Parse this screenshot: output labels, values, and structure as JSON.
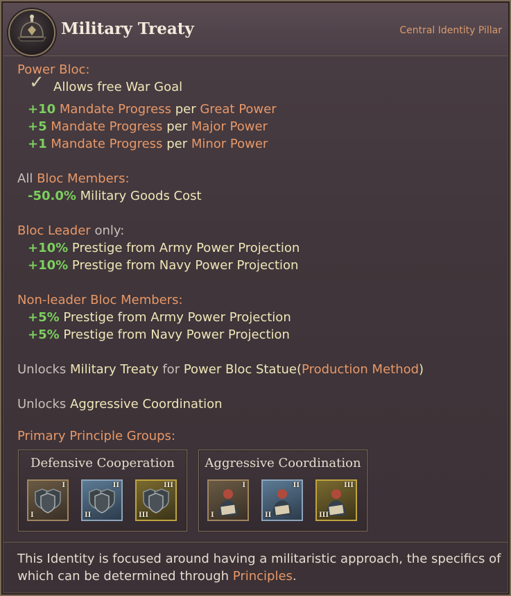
{
  "header": {
    "title": "Military Treaty",
    "pillar": "Central Identity Pillar",
    "emblem_icon": "pickelhaube-helmet-icon"
  },
  "power_bloc": {
    "label": "Power Bloc:",
    "free_war_goal": "Allows free War Goal",
    "check_icon": "checkmark-icon",
    "mandate": [
      {
        "value": "+10",
        "metric": "Mandate Progress",
        "per": "per",
        "target": "Great Power"
      },
      {
        "value": "+5",
        "metric": "Mandate Progress",
        "per": "per",
        "target": "Major Power"
      },
      {
        "value": "+1",
        "metric": "Mandate Progress",
        "per": "per",
        "target": "Minor Power"
      }
    ]
  },
  "all_members": {
    "prefix": "All",
    "label": "Bloc Members:",
    "effect_value": "-50.0%",
    "effect_text": "Military Goods Cost"
  },
  "leader": {
    "label": "Bloc Leader",
    "suffix": "only:",
    "effects": [
      {
        "value": "+10%",
        "text": "Prestige from Army Power Projection"
      },
      {
        "value": "+10%",
        "text": "Prestige from Navy Power Projection"
      }
    ]
  },
  "non_leader": {
    "label": "Non-leader Bloc Members:",
    "effects": [
      {
        "value": "+5%",
        "text": "Prestige from Army Power Projection"
      },
      {
        "value": "+5%",
        "text": "Prestige from Navy Power Projection"
      }
    ]
  },
  "unlock1": {
    "prefix": "Unlocks",
    "item": "Military Treaty",
    "for": "for",
    "building": "Power Bloc Statue",
    "open": "(",
    "method": "Production Method",
    "close": ")"
  },
  "unlock2": {
    "prefix": "Unlocks",
    "item": "Aggressive Coordination"
  },
  "principles": {
    "label": "Primary Principle Groups:",
    "groups": [
      {
        "name": "Defensive Cooperation",
        "icon": "shields-icon",
        "tiers": [
          {
            "tr": "I",
            "bl": "I"
          },
          {
            "tr": "II",
            "bl": "II"
          },
          {
            "tr": "III",
            "bl": "III"
          }
        ]
      },
      {
        "name": "Aggressive Coordination",
        "icon": "officer-with-document-icon",
        "tiers": [
          {
            "tr": "I",
            "bl": "I"
          },
          {
            "tr": "II",
            "bl": "II"
          },
          {
            "tr": "III",
            "bl": "III"
          }
        ]
      }
    ]
  },
  "footer": {
    "text": "This Identity is focused around having a militaristic approach, the specifics of which can be determined through",
    "link": "Principles",
    "end": "."
  },
  "colors": {
    "positive": "#7ccf5e",
    "highlight": "#e89868",
    "text": "#f0e6b8"
  }
}
